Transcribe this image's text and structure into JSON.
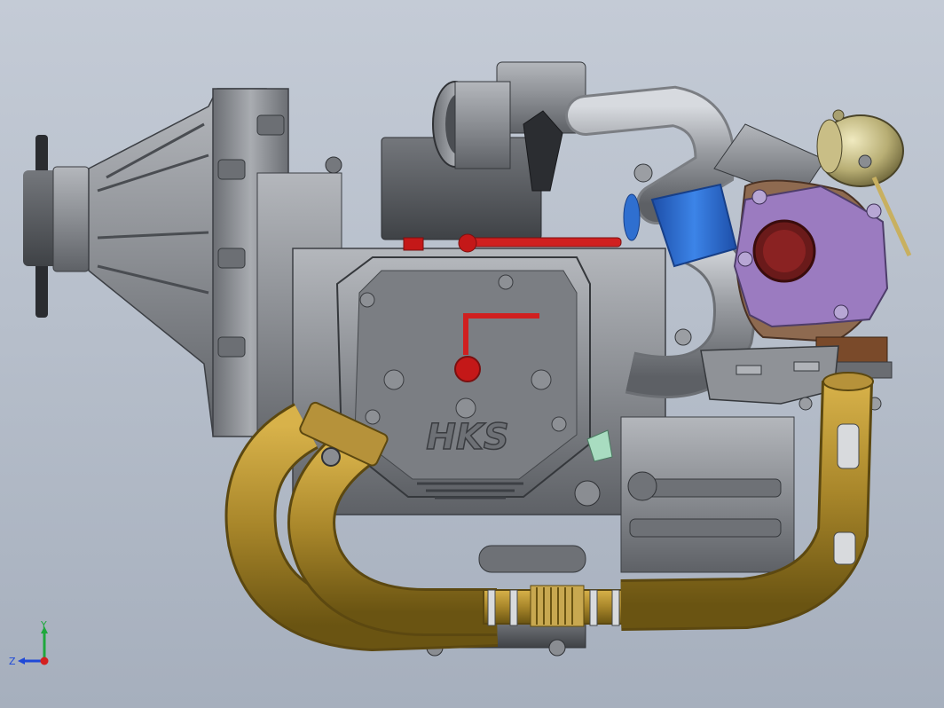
{
  "viewport": {
    "background_top": "#c4cbd6",
    "background_bottom": "#a6afbd"
  },
  "model": {
    "cover_logo": "HKS",
    "colors": {
      "metal": "#8a8d92",
      "metal_dark": "#55585d",
      "exhaust": "#a8862a",
      "intercooler_coupler": "#2f6fd0",
      "turbo_flange": "#9b7bc0",
      "fuel_line": "#d02020",
      "fitting": "#a8dcc0"
    }
  },
  "triad": {
    "y_label": "Y",
    "z_label": "Z",
    "y_color": "#1ea83c",
    "z_color": "#1f49d8",
    "x_color": "#d42020"
  }
}
